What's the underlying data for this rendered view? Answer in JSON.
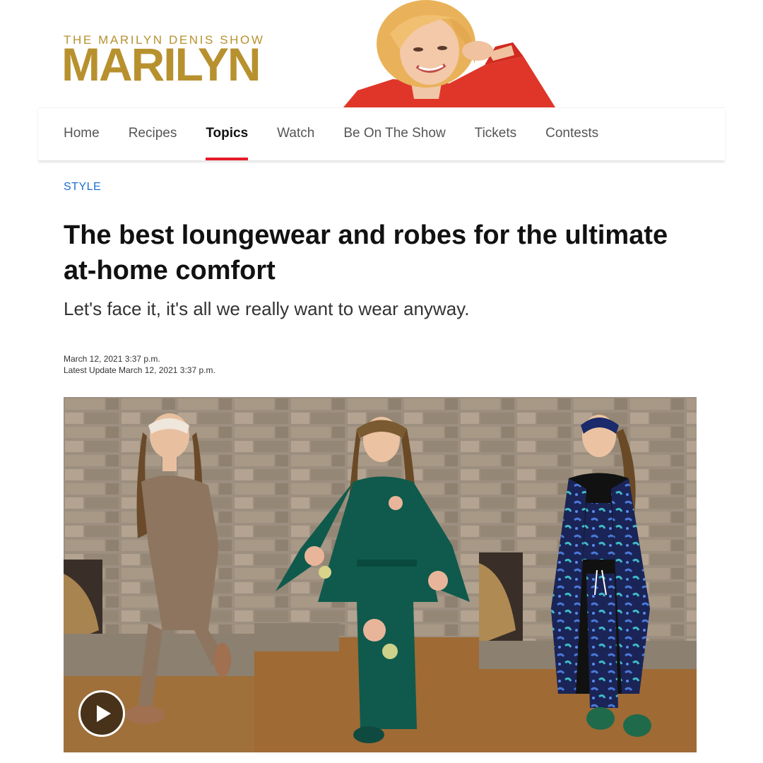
{
  "brand": {
    "show_name": "THE MARILYN DENIS SHOW",
    "logo_text": "MARILYN",
    "gold_color": "#b8912f"
  },
  "nav": {
    "items": [
      {
        "label": "Home"
      },
      {
        "label": "Recipes"
      },
      {
        "label": "Topics",
        "active": true
      },
      {
        "label": "Watch"
      },
      {
        "label": "Be On The Show"
      },
      {
        "label": "Tickets"
      },
      {
        "label": "Contests"
      }
    ],
    "active_color": "#e51b2a"
  },
  "article": {
    "category": "STYLE",
    "headline": "The best loungewear and robes for the ultimate at-home comfort",
    "dek": "Let's face it, it's all we really want to wear anyway.",
    "published": "March 12, 2021 3:37 p.m.",
    "updated": "Latest Update March 12, 2021 3:37 p.m."
  },
  "media": {
    "play_icon": "play-icon",
    "panels": [
      "taupe-loungewear",
      "green-floral-robe",
      "navy-print-cardigan"
    ]
  }
}
